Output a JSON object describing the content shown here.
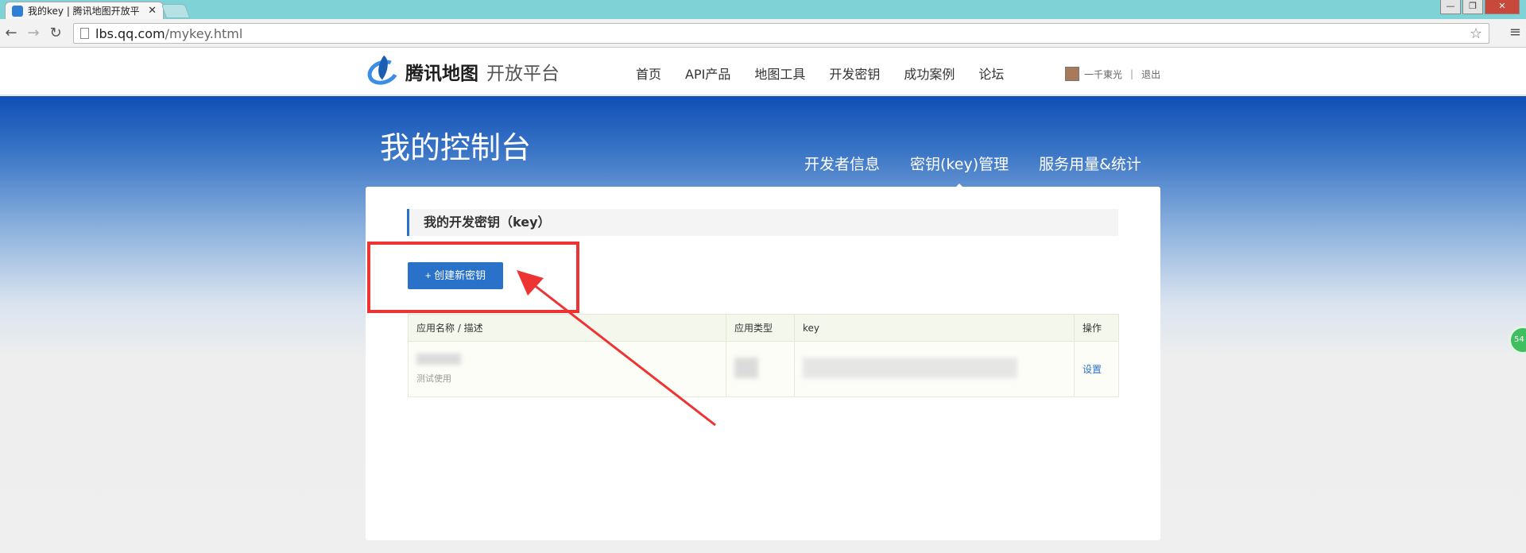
{
  "browser": {
    "tab_title": "我的key | 腾讯地图开放平",
    "url_host": "lbs.qq.com",
    "url_path": "/mykey.html",
    "window_controls": [
      "—",
      "❐",
      "✕"
    ]
  },
  "header": {
    "logo_name": "腾讯地图",
    "logo_sub": "开放平台",
    "nav": [
      "首页",
      "API产品",
      "地图工具",
      "开发密钥",
      "成功案例",
      "论坛"
    ],
    "username": "一千東光",
    "separator": "|",
    "logout": "退出"
  },
  "console": {
    "title": "我的控制台",
    "tabs": [
      "开发者信息",
      "密钥(key)管理",
      "服务用量&统计"
    ],
    "active_tab": "密钥(key)管理"
  },
  "keys_section": {
    "heading": "我的开发密钥（key）",
    "create_button": "+ 创建新密钥",
    "columns": [
      "应用名称 / 描述",
      "应用类型",
      "key",
      "操作"
    ],
    "rows": [
      {
        "app_desc": "测试使用",
        "action": "设置"
      }
    ]
  },
  "side_widget_text": "54",
  "colors": {
    "brand_blue": "#2a72c9",
    "banner_top": "#0f4eb6",
    "highlight_red": "#ee3333"
  }
}
